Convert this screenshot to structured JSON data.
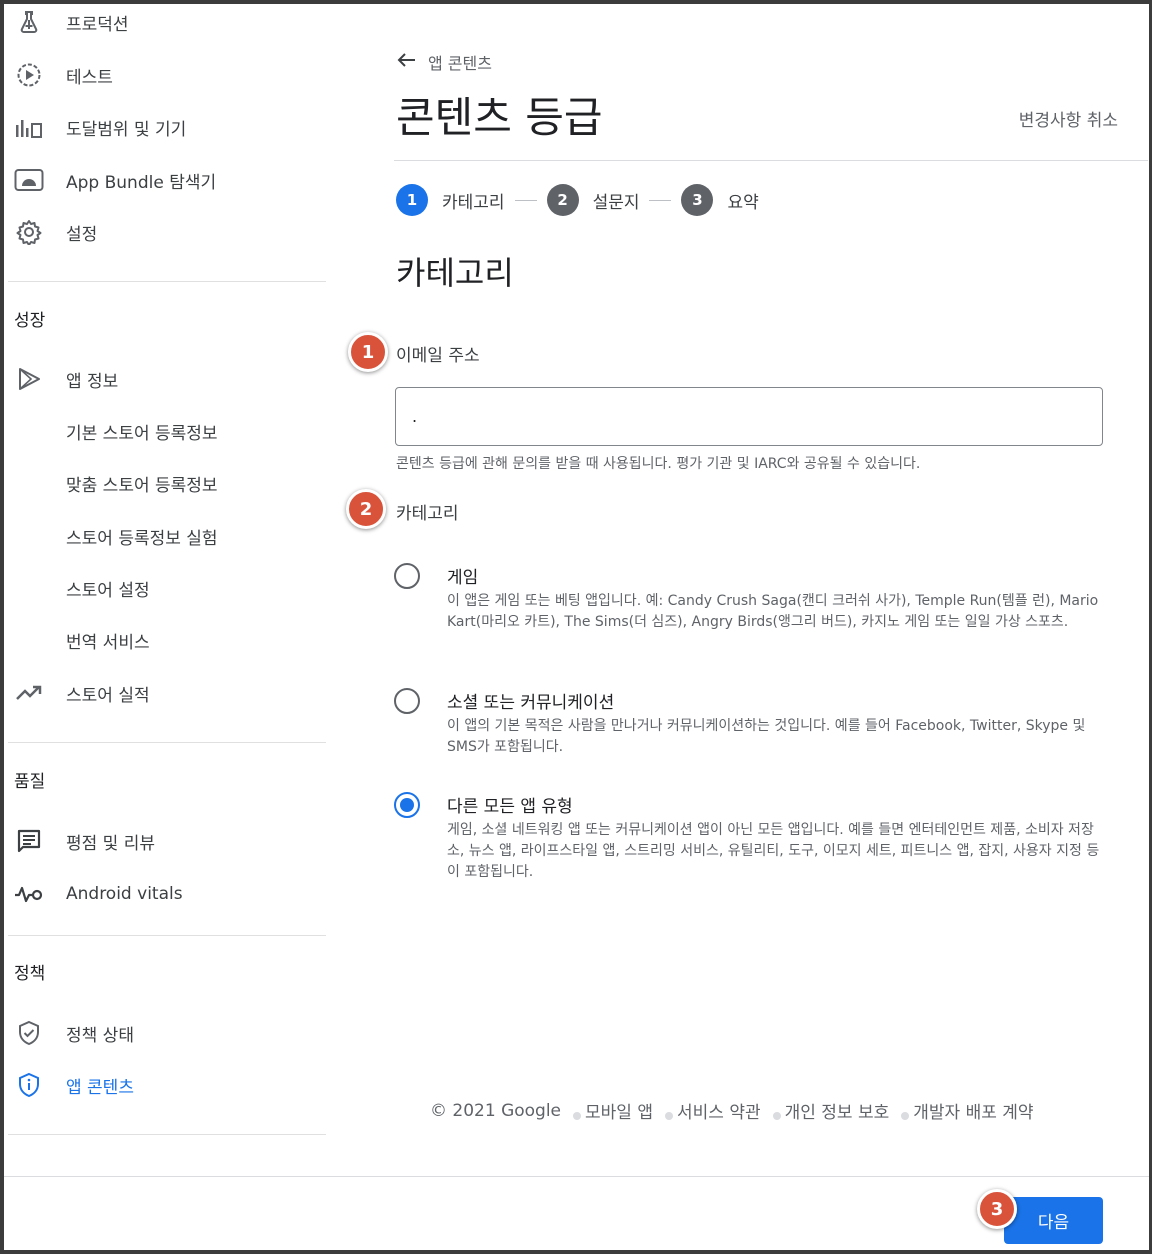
{
  "sidebar": {
    "top_items": [
      {
        "label": "프로덕션",
        "icon": "flask-icon"
      },
      {
        "label": "테스트",
        "icon": "play-circle-icon"
      },
      {
        "label": "도달범위 및 기기",
        "icon": "bar-chart-icon"
      },
      {
        "label": "App Bundle 탐색기",
        "icon": "android-icon"
      },
      {
        "label": "설정",
        "icon": "gear-icon"
      }
    ],
    "growth_title": "성장",
    "growth_items": [
      {
        "label": "앱 정보",
        "icon": "play-icon"
      },
      {
        "label": "기본 스토어 등록정보"
      },
      {
        "label": "맞춤 스토어 등록정보"
      },
      {
        "label": "스토어 등록정보 실험"
      },
      {
        "label": "스토어 설정"
      },
      {
        "label": "번역 서비스"
      },
      {
        "label": "스토어 실적",
        "icon": "trending-up-icon"
      }
    ],
    "quality_title": "품질",
    "quality_items": [
      {
        "label": "평점 및 리뷰",
        "icon": "review-icon"
      },
      {
        "label": "Android vitals",
        "icon": "vitals-icon"
      }
    ],
    "policy_title": "정책",
    "policy_items": [
      {
        "label": "정책 상태",
        "icon": "shield-check-icon"
      },
      {
        "label": "앱 콘텐츠",
        "icon": "shield-info-icon",
        "active": true
      }
    ]
  },
  "header": {
    "back_label": "앱 콘텐츠",
    "title": "콘텐츠 등급",
    "discard_label": "변경사항 취소"
  },
  "stepper": [
    {
      "num": "1",
      "label": "카테고리"
    },
    {
      "num": "2",
      "label": "설문지"
    },
    {
      "num": "3",
      "label": "요약"
    }
  ],
  "section_title": "카테고리",
  "badges": [
    "1",
    "2",
    "3"
  ],
  "email": {
    "label": "이메일 주소",
    "value": ".",
    "helper": "콘텐츠 등급에 관해 문의를 받을 때 사용됩니다. 평가 기관 및 IARC와 공유될 수 있습니다."
  },
  "category": {
    "label": "카테고리",
    "options": [
      {
        "title": "게임",
        "desc": "이 앱은 게임 또는 베팅 앱입니다. 예: Candy Crush Saga(캔디 크러쉬 사가), Temple Run(템플 런), Mario Kart(마리오 카트), The Sims(더 심즈), Angry Birds(앵그리 버드), 카지노 게임 또는 일일 가상 스포츠."
      },
      {
        "title": "소셜 또는 커뮤니케이션",
        "desc": "이 앱의 기본 목적은 사람을 만나거나 커뮤니케이션하는 것입니다. 예를 들어 Facebook, Twitter, Skype 및 SMS가 포함됩니다."
      },
      {
        "title": "다른 모든 앱 유형",
        "desc": "게임, 소셜 네트워킹 앱 또는 커뮤니케이션 앱이 아닌 모든 앱입니다. 예를 들면 엔터테인먼트 제품, 소비자 저장소, 뉴스 앱, 라이프스타일 앱, 스트리밍 서비스, 유틸리티, 도구, 이모지 세트, 피트니스 앱, 잡지, 사용자 지정 등이 포함됩니다."
      }
    ],
    "selected_index": 2
  },
  "footer": {
    "copyright": "© 2021 Google",
    "links": [
      "모바일 앱",
      "서비스 약관",
      "개인 정보 보호",
      "개발자 배포 계약"
    ]
  },
  "next_label": "다음",
  "colors": {
    "accent": "#1a73e8",
    "badge": "#d9533b"
  }
}
